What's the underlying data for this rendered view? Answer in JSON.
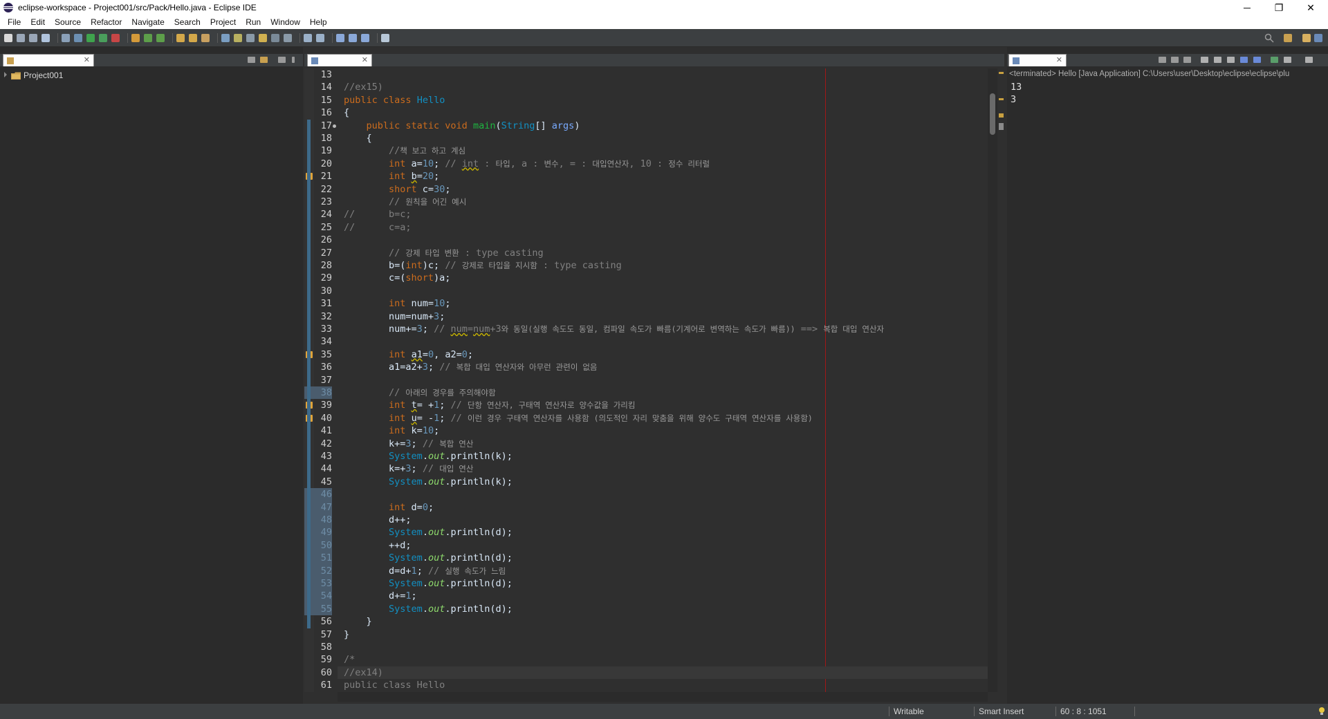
{
  "window": {
    "title": "eclipse-workspace - Project001/src/Pack/Hello.java - Eclipse IDE",
    "minimize": "─",
    "restore": "❐",
    "close": "✕"
  },
  "menu": [
    "File",
    "Edit",
    "Source",
    "Refactor",
    "Navigate",
    "Search",
    "Project",
    "Run",
    "Window",
    "Help"
  ],
  "explorer": {
    "project": "Project001",
    "tab_close": "✕"
  },
  "editor": {
    "tab_close": "✕",
    "cursor_line": 60,
    "lines": [
      {
        "n": 13,
        "html": ""
      },
      {
        "n": 14,
        "html": "<span class=\"cm\">//ex15)</span>"
      },
      {
        "n": 15,
        "html": "<span class=\"kw\">public class</span> <span class=\"ty\">Hello</span>"
      },
      {
        "n": 16,
        "html": "{"
      },
      {
        "n": 17,
        "html": "    <span class=\"kw\">public static void</span> <span class=\"fn\">main</span>(<span class=\"ty\">String</span>[] <span class=\"var\">args</span>)"
      },
      {
        "n": 18,
        "html": "    {"
      },
      {
        "n": 19,
        "html": "        <span class=\"cm\">//</span><span class=\"cmk\">책 보고 하고 계심</span>"
      },
      {
        "n": 20,
        "html": "        <span class=\"kw\">int</span> a=<span class=\"num\">10</span>; <span class=\"cm\">// <span class=\"wave\">int</span> : </span><span class=\"cmk\">타입</span><span class=\"cm\">, a : </span><span class=\"cmk\">변수</span><span class=\"cm\">, = : </span><span class=\"cmk\">대입연산자</span><span class=\"cm\">, 10 : </span><span class=\"cmk\">정수 리터럴</span>"
      },
      {
        "n": 21,
        "html": "        <span class=\"kw\">int</span> <span class=\"wave\">b</span>=<span class=\"num\">20</span>;"
      },
      {
        "n": 22,
        "html": "        <span class=\"kw\">short</span> c=<span class=\"num\">30</span>;"
      },
      {
        "n": 23,
        "html": "        <span class=\"cm\">// </span><span class=\"cmk\">원칙을 어긴 예시</span>"
      },
      {
        "n": 24,
        "html": "<span class=\"cm\">//      b=c;</span>"
      },
      {
        "n": 25,
        "html": "<span class=\"cm\">//      c=a;</span>"
      },
      {
        "n": 26,
        "html": ""
      },
      {
        "n": 27,
        "html": "        <span class=\"cm\">// </span><span class=\"cmk\">강제 타입 변환</span><span class=\"cm\"> : type casting</span>"
      },
      {
        "n": 28,
        "html": "        b=(<span class=\"kw\">int</span>)c; <span class=\"cm\">// </span><span class=\"cmk\">강제로 타입을 지시함</span><span class=\"cm\"> : type casting</span>"
      },
      {
        "n": 29,
        "html": "        c=(<span class=\"kw\">short</span>)a;"
      },
      {
        "n": 30,
        "html": ""
      },
      {
        "n": 31,
        "html": "        <span class=\"kw\">int</span> num=<span class=\"num\">10</span>;"
      },
      {
        "n": 32,
        "html": "        num=num+<span class=\"num\">3</span>;"
      },
      {
        "n": 33,
        "html": "        num+=<span class=\"num\">3</span>; <span class=\"cm\">// <span class=\"wave\">num</span>=<span class=\"wave\">num</span>+3</span><span class=\"cmk\">와 동일(실행 속도도 동일, 컴파일 속도가 빠름(기계어로 변역하는 속도가 빠름))</span><span class=\"cm\"> ==> </span><span class=\"cmk\">복합 대입 연산자</span>"
      },
      {
        "n": 34,
        "html": ""
      },
      {
        "n": 35,
        "html": "        <span class=\"kw\">int</span> <span class=\"wave\">a1</span>=<span class=\"num\">0</span>, a2=<span class=\"num\">0</span>;"
      },
      {
        "n": 36,
        "html": "        a1=a2+<span class=\"num\">3</span>; <span class=\"cm\">// </span><span class=\"cmk\">복합 대입 연산자와 아무런 관련이 없음</span>"
      },
      {
        "n": 37,
        "html": ""
      },
      {
        "n": 38,
        "html": "        <span class=\"cm\">// </span><span class=\"cmk\">아래의 경우를 주의해야함</span>"
      },
      {
        "n": 39,
        "html": "        <span class=\"kw\">int</span> <span class=\"wave\">t</span>= +<span class=\"num\">1</span>; <span class=\"cm\">// </span><span class=\"cmk\">단항 연산자, 구태역 연산자로 양수값을 가리킴</span>"
      },
      {
        "n": 40,
        "html": "        <span class=\"kw\">int</span> <span class=\"wave\">u</span>= -<span class=\"num\">1</span>; <span class=\"cm\">// </span><span class=\"cmk\">이런 경우 구태역 연산자를 사용함 (의도적인 자리 맞춤을 위해 양수도 구태역 연산자를 사용함)</span>"
      },
      {
        "n": 41,
        "html": "        <span class=\"kw\">int</span> k=<span class=\"num\">10</span>;"
      },
      {
        "n": 42,
        "html": "        k+=<span class=\"num\">3</span>; <span class=\"cm\">// </span><span class=\"cmk\">복합 연산</span>"
      },
      {
        "n": 43,
        "html": "        <span class=\"sys\">System</span>.<span class=\"out\">out</span>.println(k);"
      },
      {
        "n": 44,
        "html": "        k=+<span class=\"num\">3</span>; <span class=\"cm\">// </span><span class=\"cmk\">대입 연산</span>"
      },
      {
        "n": 45,
        "html": "        <span class=\"sys\">System</span>.<span class=\"out\">out</span>.println(k);"
      },
      {
        "n": 46,
        "html": ""
      },
      {
        "n": 47,
        "html": "        <span class=\"kw\">int</span> d=<span class=\"num\">0</span>;"
      },
      {
        "n": 48,
        "html": "        d++;"
      },
      {
        "n": 49,
        "html": "        <span class=\"sys\">System</span>.<span class=\"out\">out</span>.println(d);"
      },
      {
        "n": 50,
        "html": "        ++d;"
      },
      {
        "n": 51,
        "html": "        <span class=\"sys\">System</span>.<span class=\"out\">out</span>.println(d);"
      },
      {
        "n": 52,
        "html": "        d=d+<span class=\"num\">1</span>; <span class=\"cm\">// </span><span class=\"cmk\">실행 속도가 느림</span>"
      },
      {
        "n": 53,
        "html": "        <span class=\"sys\">System</span>.<span class=\"out\">out</span>.println(d);"
      },
      {
        "n": 54,
        "html": "        d+=<span class=\"num\">1</span>;"
      },
      {
        "n": 55,
        "html": "        <span class=\"sys\">System</span>.<span class=\"out\">out</span>.println(d);"
      },
      {
        "n": 56,
        "html": "    }"
      },
      {
        "n": 57,
        "html": "}"
      },
      {
        "n": 58,
        "html": ""
      },
      {
        "n": 59,
        "html": "<span class=\"cm\">/*</span>"
      },
      {
        "n": 60,
        "html": "<span class=\"cm\">//ex14)</span>"
      },
      {
        "n": 61,
        "html": "<span class=\"cm\">public class Hello</span>"
      }
    ],
    "highlighted_lines": [
      38,
      46,
      47,
      48,
      49,
      50,
      51,
      52,
      53,
      54,
      55
    ],
    "warning_lines": [
      21,
      35,
      39,
      40
    ]
  },
  "console": {
    "header": "<terminated> Hello [Java Application] C:\\Users\\user\\Desktop\\eclipse\\eclipse\\plu",
    "output": [
      "13",
      "3"
    ],
    "tab_close": "✕"
  },
  "status": {
    "writable": "Writable",
    "insert_mode": "Smart Insert",
    "position": "60 : 8 : 1051"
  },
  "colors": {
    "background": "#2f2f2f",
    "keyword": "#cc6c1d",
    "type": "#1290c3",
    "comment": "#808080",
    "print_margin": "#a01818"
  }
}
